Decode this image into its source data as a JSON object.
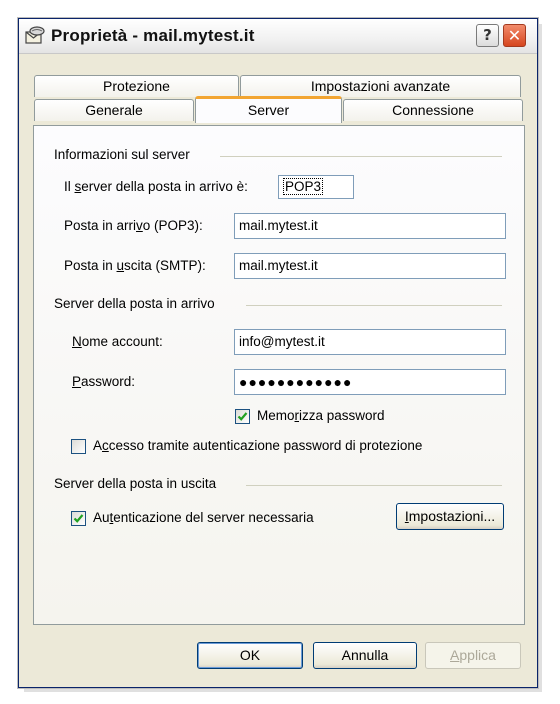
{
  "window": {
    "title": "Proprietà - mail.mytest.it",
    "help_glyph": "?",
    "close_glyph": "✕"
  },
  "tabs": {
    "row_back": [
      "Protezione",
      "Impostazioni avanzate"
    ],
    "row_front": [
      "Generale",
      "Server",
      "Connessione"
    ],
    "active": "Server"
  },
  "server_info": {
    "group_label": "Informazioni sul server",
    "incoming_type": {
      "pre": "Il ",
      "ul": "s",
      "post": "erver della posta in arrivo è:",
      "value": "POP3"
    },
    "incoming": {
      "pre": "Posta in arri",
      "ul": "v",
      "post": "o (POP3):",
      "value": "mail.mytest.it"
    },
    "outgoing": {
      "pre": "Posta in ",
      "ul": "u",
      "post": "scita (SMTP):",
      "value": "mail.mytest.it"
    }
  },
  "incoming_server": {
    "group_label": "Server della posta in arrivo",
    "account": {
      "ul": "N",
      "post": "ome account:",
      "value": "info@mytest.it"
    },
    "password": {
      "ul": "P",
      "post": "assword:",
      "value": "●●●●●●●●●●●●"
    },
    "remember": {
      "pre": "Memo",
      "ul": "r",
      "post": "izza password",
      "checked": true
    },
    "spa": {
      "pre": "A",
      "ul": "c",
      "post": "cesso tramite autenticazione password di protezione",
      "checked": false
    }
  },
  "outgoing_server": {
    "group_label": "Server della posta in uscita",
    "auth": {
      "pre": "Au",
      "ul": "t",
      "post": "enticazione del server necessaria",
      "checked": true
    },
    "settings_button": {
      "ul": "I",
      "post": "mpostazioni..."
    }
  },
  "buttons": {
    "ok": "OK",
    "cancel": "Annulla",
    "apply_ul": "A",
    "apply_post": "pplica"
  },
  "colors": {
    "accent_tab": "#f2a531",
    "field_border": "#7f9db9",
    "check": "#21a121"
  }
}
